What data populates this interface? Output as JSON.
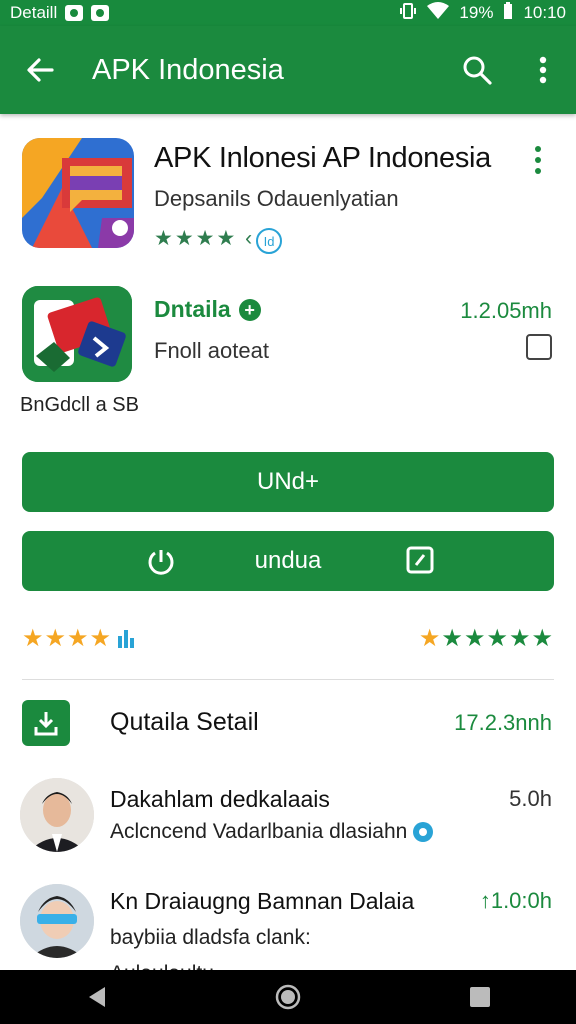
{
  "status_bar": {
    "carrier": "Detaill",
    "battery": "19%",
    "time": "10:10",
    "icons": [
      "notification-icon",
      "image-icon",
      "vibrate-icon",
      "wifi-icon",
      "battery-icon"
    ]
  },
  "app_bar": {
    "title": "APK Indonesia",
    "back_icon": "arrow-back-icon",
    "search_icon": "search-icon",
    "menu_icon": "more-vert-icon"
  },
  "app": {
    "title": "APK Inlonesi AP Indonesia",
    "subtitle": "Depsanils Odauenlyatian",
    "stars": "★★★★ ‹",
    "badge": "Id"
  },
  "download": {
    "name": "Dntaila",
    "size": "1.2.05mh",
    "subtitle": "Fnoll aoteat",
    "bundle_label": "BnGdcll a SB"
  },
  "buttons": {
    "primary_label": "UNd+",
    "secondary_label": "undua"
  },
  "ratings": {
    "left_stars": "★★★★",
    "right_gold": "★",
    "right_green": "★★★★★"
  },
  "section": {
    "title": "Qutaila Setail",
    "size": "17.2.3nnh",
    "icon": "download-icon"
  },
  "reviews": [
    {
      "name": "Dakahlam dedkalaais",
      "text": "Aclcncend Vadarlbania dlasiahn",
      "time": "5.0h"
    },
    {
      "name": "Kn Draiaugng Bamnan Dalaia",
      "text": "baybiia dladsfa clank:",
      "time": "1.0:0h",
      "time_prefix": "↑"
    }
  ],
  "truncated_text": "Aulaulaultu",
  "nav": {
    "icons": [
      "back-nav-icon",
      "home-nav-icon",
      "recents-nav-icon"
    ]
  },
  "colors": {
    "primary": "#1b8a3e",
    "star_gold": "#f5a623",
    "accent_blue": "#29a3d6"
  }
}
